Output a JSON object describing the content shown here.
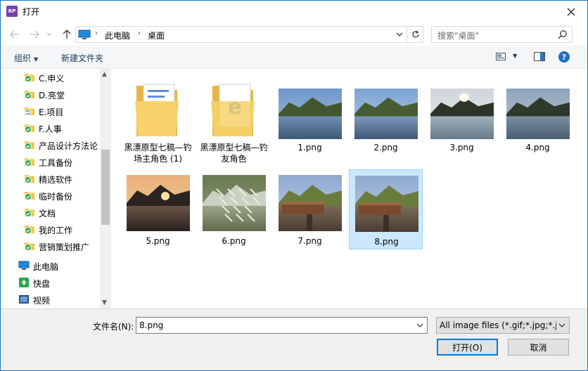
{
  "window": {
    "title": "打开",
    "app_icon_text": "RP"
  },
  "address": {
    "crumbs": [
      "此电脑",
      "桌面"
    ]
  },
  "search": {
    "placeholder": "搜索\"桌面\""
  },
  "toolbar": {
    "organize_label": "组织",
    "new_folder_label": "新建文件夹"
  },
  "sidebar": {
    "items": [
      {
        "label": "C.申义",
        "icon": "folder-synced-icon"
      },
      {
        "label": "D.亮堂",
        "icon": "folder-synced-icon"
      },
      {
        "label": "E.项目",
        "icon": "folder-syncing-icon"
      },
      {
        "label": "F.人事",
        "icon": "folder-synced-icon"
      },
      {
        "label": "产品设计方法论",
        "icon": "folder-synced-icon"
      },
      {
        "label": "工具备份",
        "icon": "folder-synced-icon"
      },
      {
        "label": "精选软件",
        "icon": "folder-synced-icon"
      },
      {
        "label": "临时备份",
        "icon": "folder-synced-icon"
      },
      {
        "label": "文档",
        "icon": "folder-synced-icon"
      },
      {
        "label": "我的工作",
        "icon": "folder-synced-icon"
      },
      {
        "label": "营销策划推广",
        "icon": "folder-synced-icon"
      },
      {
        "label": "此电脑",
        "icon": "computer-icon"
      },
      {
        "label": "快盘",
        "icon": "kuaipan-icon"
      },
      {
        "label": "视频",
        "icon": "video-icon"
      }
    ]
  },
  "files": [
    {
      "label": "黑漂原型七稿—钓场主角色 (1)",
      "kind": "folder-docs"
    },
    {
      "label": "黑漂原型七稿—钓友角色",
      "kind": "folder-ie"
    },
    {
      "label": "1.png",
      "kind": "image"
    },
    {
      "label": "2.png",
      "kind": "image"
    },
    {
      "label": "3.png",
      "kind": "image"
    },
    {
      "label": "4.png",
      "kind": "image"
    },
    {
      "label": "5.png",
      "kind": "image"
    },
    {
      "label": "6.png",
      "kind": "image"
    },
    {
      "label": "7.png",
      "kind": "image"
    },
    {
      "label": "8.png",
      "kind": "image",
      "selected": true
    }
  ],
  "bottom": {
    "filename_label": "文件名(N):",
    "filename_value": "8.png",
    "filter_value": "All image files (*.gif;*.jpg;*.jp",
    "open_label": "打开(O)",
    "cancel_label": "取消"
  }
}
